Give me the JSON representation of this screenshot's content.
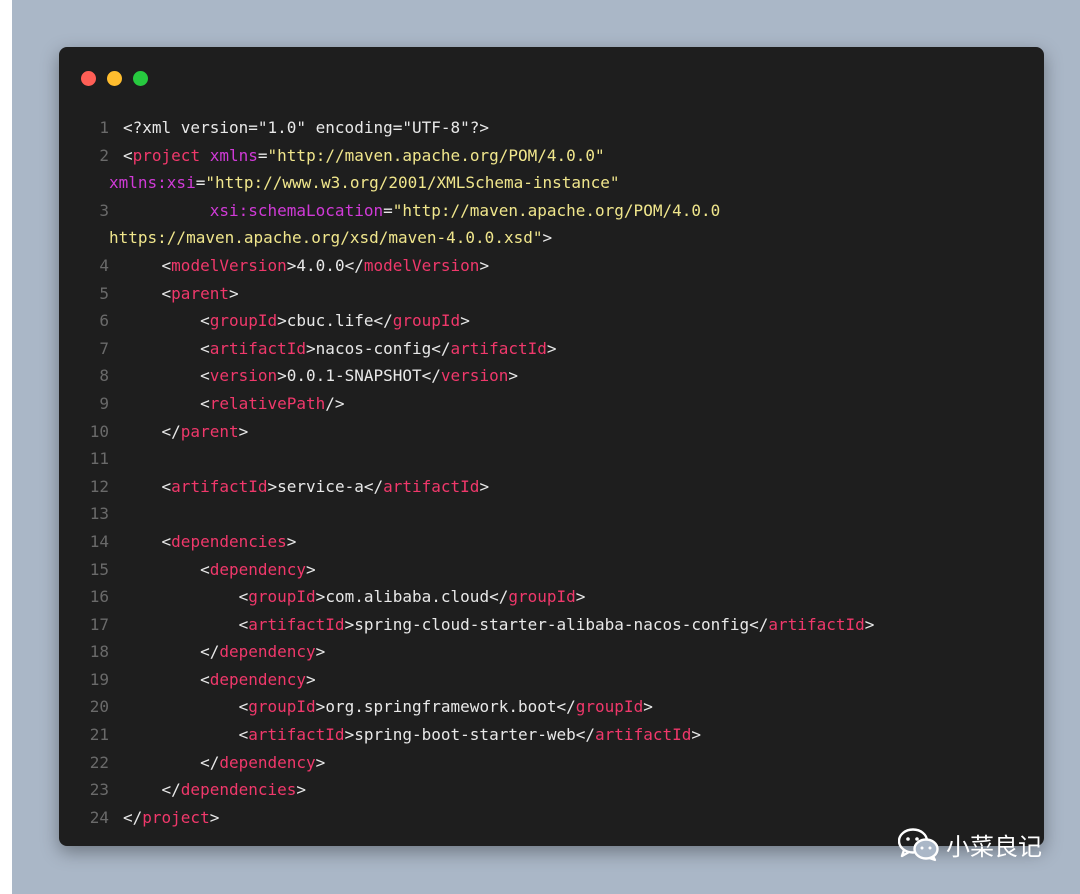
{
  "window": {
    "traffic_lights": [
      {
        "name": "close",
        "color": "#ff5f56"
      },
      {
        "name": "minimize",
        "color": "#ffbd2e"
      },
      {
        "name": "maximize",
        "color": "#27c93f"
      }
    ]
  },
  "code": {
    "language": "xml",
    "lines": [
      {
        "n": "1",
        "indent": "",
        "tokens": [
          [
            "txt",
            "<?xml version=\"1.0\" encoding=\"UTF-8\"?>"
          ]
        ]
      },
      {
        "n": "2",
        "indent": "",
        "tokens": [
          [
            "punc",
            "<"
          ],
          [
            "tag",
            "project"
          ],
          [
            "txt",
            " "
          ],
          [
            "attr",
            "xmlns"
          ],
          [
            "punc",
            "="
          ],
          [
            "str",
            "\"http://maven.apache.org/POM/4.0.0\""
          ]
        ]
      },
      {
        "n": "",
        "wrap": true,
        "indent": "",
        "tokens": [
          [
            "attr",
            "xmlns:xsi"
          ],
          [
            "punc",
            "="
          ],
          [
            "str",
            "\"http://www.w3.org/2001/XMLSchema-instance\""
          ]
        ]
      },
      {
        "n": "3",
        "indent": "         ",
        "tokens": [
          [
            "attr",
            "xsi:schemaLocation"
          ],
          [
            "punc",
            "="
          ],
          [
            "str",
            "\"http://maven.apache.org/POM/4.0.0"
          ]
        ]
      },
      {
        "n": "",
        "wrap": true,
        "indent": "",
        "tokens": [
          [
            "str",
            "https://maven.apache.org/xsd/maven-4.0.0.xsd\""
          ],
          [
            "punc",
            ">"
          ]
        ]
      },
      {
        "n": "4",
        "indent": "    ",
        "tokens": [
          [
            "punc",
            "<"
          ],
          [
            "tag",
            "modelVersion"
          ],
          [
            "punc",
            ">"
          ],
          [
            "txt",
            "4.0.0"
          ],
          [
            "punc",
            "</"
          ],
          [
            "tag",
            "modelVersion"
          ],
          [
            "punc",
            ">"
          ]
        ]
      },
      {
        "n": "5",
        "indent": "    ",
        "tokens": [
          [
            "punc",
            "<"
          ],
          [
            "tag",
            "parent"
          ],
          [
            "punc",
            ">"
          ]
        ]
      },
      {
        "n": "6",
        "indent": "        ",
        "tokens": [
          [
            "punc",
            "<"
          ],
          [
            "tag",
            "groupId"
          ],
          [
            "punc",
            ">"
          ],
          [
            "txt",
            "cbuc.life"
          ],
          [
            "punc",
            "</"
          ],
          [
            "tag",
            "groupId"
          ],
          [
            "punc",
            ">"
          ]
        ]
      },
      {
        "n": "7",
        "indent": "        ",
        "tokens": [
          [
            "punc",
            "<"
          ],
          [
            "tag",
            "artifactId"
          ],
          [
            "punc",
            ">"
          ],
          [
            "txt",
            "nacos-config"
          ],
          [
            "punc",
            "</"
          ],
          [
            "tag",
            "artifactId"
          ],
          [
            "punc",
            ">"
          ]
        ]
      },
      {
        "n": "8",
        "indent": "        ",
        "tokens": [
          [
            "punc",
            "<"
          ],
          [
            "tag",
            "version"
          ],
          [
            "punc",
            ">"
          ],
          [
            "txt",
            "0.0.1-SNAPSHOT"
          ],
          [
            "punc",
            "</"
          ],
          [
            "tag",
            "version"
          ],
          [
            "punc",
            ">"
          ]
        ]
      },
      {
        "n": "9",
        "indent": "        ",
        "tokens": [
          [
            "punc",
            "<"
          ],
          [
            "tag",
            "relativePath"
          ],
          [
            "punc",
            "/>"
          ]
        ]
      },
      {
        "n": "10",
        "indent": "    ",
        "tokens": [
          [
            "punc",
            "</"
          ],
          [
            "tag",
            "parent"
          ],
          [
            "punc",
            ">"
          ]
        ]
      },
      {
        "n": "11",
        "indent": "",
        "tokens": []
      },
      {
        "n": "12",
        "indent": "    ",
        "tokens": [
          [
            "punc",
            "<"
          ],
          [
            "tag",
            "artifactId"
          ],
          [
            "punc",
            ">"
          ],
          [
            "txt",
            "service-a"
          ],
          [
            "punc",
            "</"
          ],
          [
            "tag",
            "artifactId"
          ],
          [
            "punc",
            ">"
          ]
        ]
      },
      {
        "n": "13",
        "indent": "",
        "tokens": []
      },
      {
        "n": "14",
        "indent": "    ",
        "tokens": [
          [
            "punc",
            "<"
          ],
          [
            "tag",
            "dependencies"
          ],
          [
            "punc",
            ">"
          ]
        ]
      },
      {
        "n": "15",
        "indent": "        ",
        "tokens": [
          [
            "punc",
            "<"
          ],
          [
            "tag",
            "dependency"
          ],
          [
            "punc",
            ">"
          ]
        ]
      },
      {
        "n": "16",
        "indent": "            ",
        "tokens": [
          [
            "punc",
            "<"
          ],
          [
            "tag",
            "groupId"
          ],
          [
            "punc",
            ">"
          ],
          [
            "txt",
            "com.alibaba.cloud"
          ],
          [
            "punc",
            "</"
          ],
          [
            "tag",
            "groupId"
          ],
          [
            "punc",
            ">"
          ]
        ]
      },
      {
        "n": "17",
        "indent": "            ",
        "tokens": [
          [
            "punc",
            "<"
          ],
          [
            "tag",
            "artifactId"
          ],
          [
            "punc",
            ">"
          ],
          [
            "txt",
            "spring-cloud-starter-alibaba-nacos-config"
          ],
          [
            "punc",
            "</"
          ],
          [
            "tag",
            "artifactId"
          ],
          [
            "punc",
            ">"
          ]
        ]
      },
      {
        "n": "18",
        "indent": "        ",
        "tokens": [
          [
            "punc",
            "</"
          ],
          [
            "tag",
            "dependency"
          ],
          [
            "punc",
            ">"
          ]
        ]
      },
      {
        "n": "19",
        "indent": "        ",
        "tokens": [
          [
            "punc",
            "<"
          ],
          [
            "tag",
            "dependency"
          ],
          [
            "punc",
            ">"
          ]
        ]
      },
      {
        "n": "20",
        "indent": "            ",
        "tokens": [
          [
            "punc",
            "<"
          ],
          [
            "tag",
            "groupId"
          ],
          [
            "punc",
            ">"
          ],
          [
            "txt",
            "org.springframework.boot"
          ],
          [
            "punc",
            "</"
          ],
          [
            "tag",
            "groupId"
          ],
          [
            "punc",
            ">"
          ]
        ]
      },
      {
        "n": "21",
        "indent": "            ",
        "tokens": [
          [
            "punc",
            "<"
          ],
          [
            "tag",
            "artifactId"
          ],
          [
            "punc",
            ">"
          ],
          [
            "txt",
            "spring-boot-starter-web"
          ],
          [
            "punc",
            "</"
          ],
          [
            "tag",
            "artifactId"
          ],
          [
            "punc",
            ">"
          ]
        ]
      },
      {
        "n": "22",
        "indent": "        ",
        "tokens": [
          [
            "punc",
            "</"
          ],
          [
            "tag",
            "dependency"
          ],
          [
            "punc",
            ">"
          ]
        ]
      },
      {
        "n": "23",
        "indent": "    ",
        "tokens": [
          [
            "punc",
            "</"
          ],
          [
            "tag",
            "dependencies"
          ],
          [
            "punc",
            ">"
          ]
        ]
      },
      {
        "n": "24",
        "indent": "",
        "tokens": [
          [
            "punc",
            "</"
          ],
          [
            "tag",
            "project"
          ],
          [
            "punc",
            ">"
          ]
        ]
      }
    ]
  },
  "watermark": {
    "icon": "wechat-icon",
    "text": "小菜良记"
  }
}
